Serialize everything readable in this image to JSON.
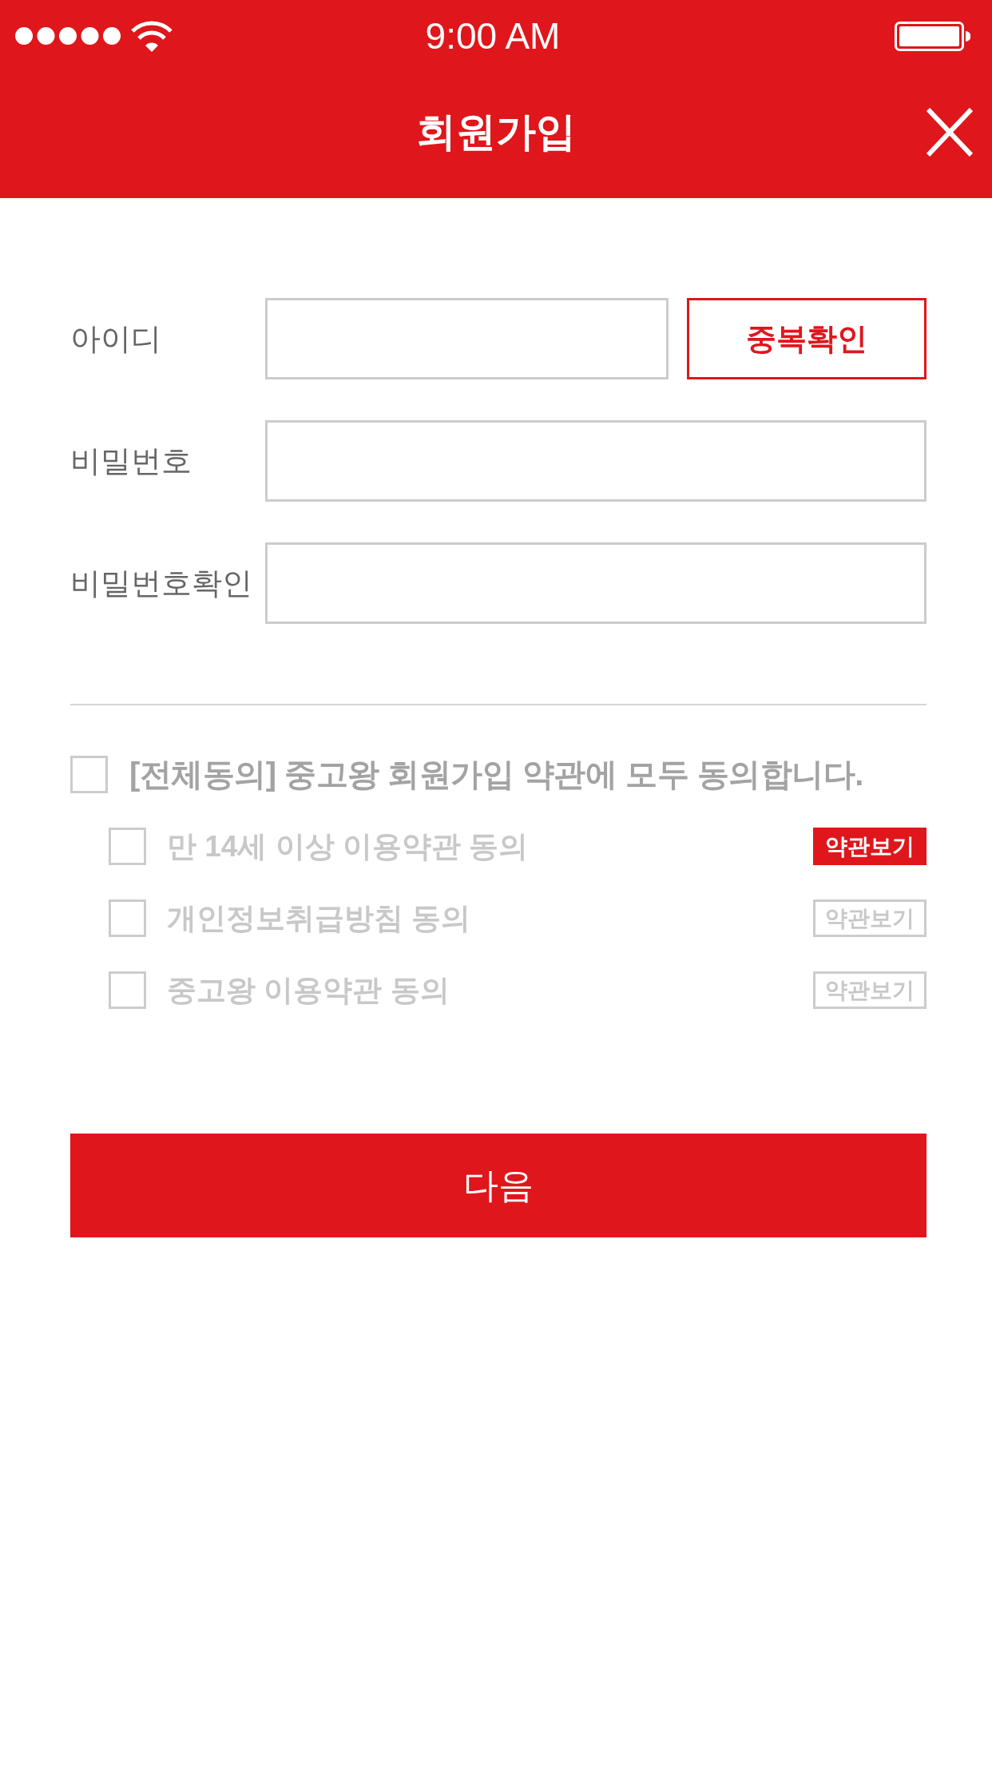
{
  "status_bar": {
    "time": "9:00 AM"
  },
  "header": {
    "title": "회원가입"
  },
  "form": {
    "fields": [
      {
        "label": "아이디",
        "kind": "with_button",
        "button": "중복확인"
      },
      {
        "label": "비밀번호",
        "kind": "plain"
      },
      {
        "label": "비밀번호확인",
        "kind": "plain"
      }
    ]
  },
  "terms": {
    "all": {
      "label": "[전체동의] 중고왕 회원가입 약관에 모두 동의합니다.",
      "checked": false
    },
    "items": [
      {
        "label": "만 14세 이상 이용약관 동의",
        "checked": false,
        "view_button": "약관보기",
        "active": true
      },
      {
        "label": "개인정보취급방침 동의",
        "checked": false,
        "view_button": "약관보기",
        "active": false
      },
      {
        "label": "중고왕 이용약관 동의",
        "checked": false,
        "view_button": "약관보기",
        "active": false
      }
    ]
  },
  "next_button": "다음"
}
